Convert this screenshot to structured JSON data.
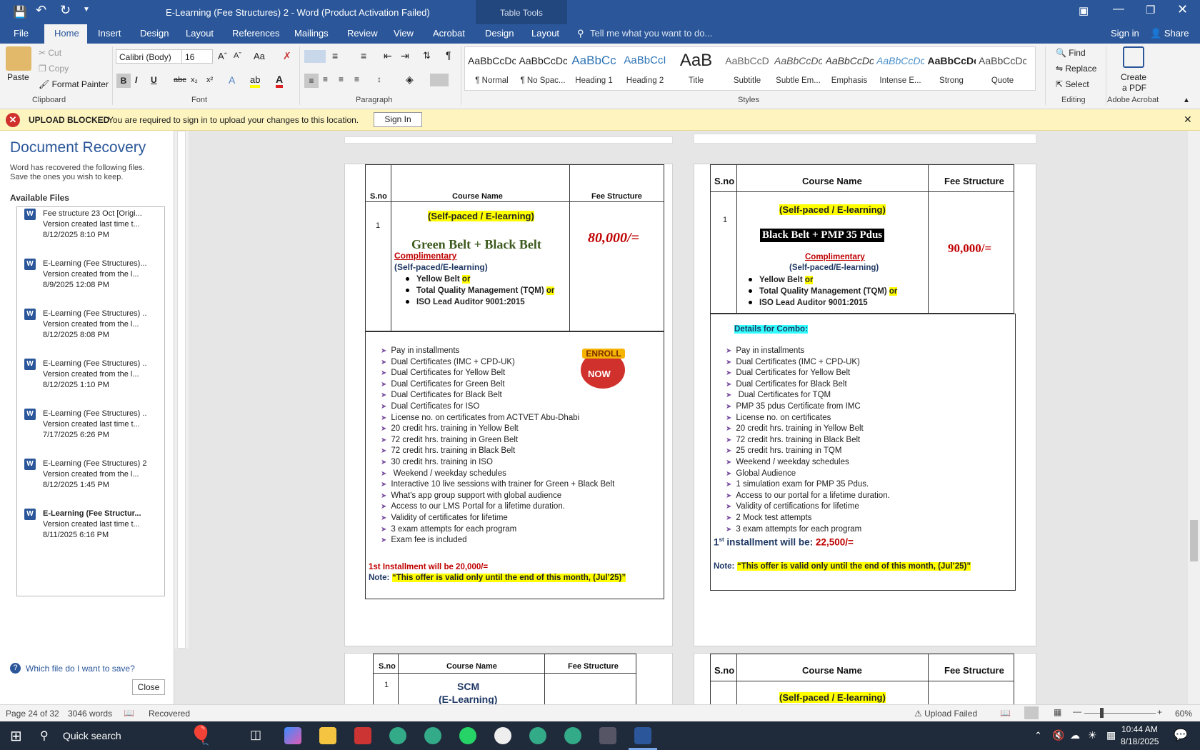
{
  "window": {
    "title": "E-Learning (Fee Structures) 2 - Word (Product Activation Failed)",
    "table_tools": "Table Tools"
  },
  "tabs": [
    "File",
    "Home",
    "Insert",
    "Design",
    "Layout",
    "References",
    "Mailings",
    "Review",
    "View",
    "Acrobat",
    "Design",
    "Layout"
  ],
  "tell_me": "Tell me what you want to do...",
  "sign_in": "Sign in",
  "share": "Share",
  "clipboard": {
    "paste": "Paste",
    "cut": "Cut",
    "copy": "Copy",
    "format_painter": "Format Painter",
    "label": "Clipboard"
  },
  "font": {
    "name": "Calibri (Body)",
    "size": "16",
    "label": "Font"
  },
  "paragraph": {
    "label": "Paragraph"
  },
  "styles": {
    "label": "Styles",
    "items": [
      {
        "preview": "AaBbCcDc",
        "name": "¶ Normal"
      },
      {
        "preview": "AaBbCcDc",
        "name": "¶ No Spac..."
      },
      {
        "preview": "AaBbCc",
        "name": "Heading 1"
      },
      {
        "preview": "AaBbCcI",
        "name": "Heading 2"
      },
      {
        "preview": "AaB",
        "name": "Title"
      },
      {
        "preview": "AaBbCcD",
        "name": "Subtitle"
      },
      {
        "preview": "AaBbCcDc",
        "name": "Subtle Em..."
      },
      {
        "preview": "AaBbCcDc",
        "name": "Emphasis"
      },
      {
        "preview": "AaBbCcDc",
        "name": "Intense E..."
      },
      {
        "preview": "AaBbCcDc",
        "name": "Strong"
      },
      {
        "preview": "AaBbCcDc",
        "name": "Quote"
      }
    ]
  },
  "editing": {
    "find": "Find",
    "replace": "Replace",
    "select": "Select",
    "label": "Editing"
  },
  "acrobat": {
    "create": "Create",
    "pdf": "a PDF",
    "label": "Adobe Acrobat"
  },
  "message": {
    "title": "UPLOAD BLOCKED",
    "text": "You are required to sign in to upload your changes to this location.",
    "button": "Sign In"
  },
  "recovery": {
    "title": "Document Recovery",
    "desc1": "Word has recovered the following files.",
    "desc2": "Save the ones you wish to keep.",
    "available": "Available Files",
    "help": "Which file do I want to save?",
    "close": "Close",
    "files": [
      {
        "name": "Fee structure 23 Oct  [Origi...",
        "ver": "Version created last time t...",
        "date": "8/12/2025 8:10 PM"
      },
      {
        "name": "E-Learning (Fee Structures)...",
        "ver": "Version created from the l...",
        "date": "8/9/2025 12:08 PM"
      },
      {
        "name": "E-Learning (Fee Structures) ..",
        "ver": "Version created from the l...",
        "date": "8/12/2025 8:08 PM"
      },
      {
        "name": "E-Learning (Fee Structures) ..",
        "ver": "Version created from the l...",
        "date": "8/12/2025 1:10 PM"
      },
      {
        "name": "E-Learning (Fee Structures) ..",
        "ver": "Version created last time t...",
        "date": "7/17/2025 6:26 PM"
      },
      {
        "name": "E-Learning (Fee Structures) 2",
        "ver": "Version created from the l...",
        "date": "8/12/2025 1:45 PM"
      },
      {
        "name": "E-Learning (Fee Structur...",
        "ver": "Version created last time t...",
        "date": "8/11/2025 6:16 PM"
      }
    ]
  },
  "table_headers": {
    "sno": "S.no",
    "course": "Course Name",
    "fee": "Fee Structure"
  },
  "left_doc": {
    "num": "1",
    "mode": "(Self-paced / E-learning)",
    "course": "Green Belt + Black Belt",
    "comp": "Complimentary",
    "comp_mode": "(Self-paced/E-learning)",
    "opt1": "Yellow Belt",
    "opt2": "Total Quality Management (TQM)",
    "opt3": "ISO Lead Auditor 9001:2015",
    "or": "or",
    "fee": "80,000/=",
    "enroll1": "ENROLL",
    "enroll2": "NOW",
    "bullets": [
      "Pay in installments",
      "Dual Certificates (IMC + CPD-UK)",
      "Dual Certificates for Yellow Belt",
      "Dual Certificates for Green Belt",
      "Dual Certificates for Black Belt",
      "Dual Certificates for  ISO",
      "License no. on certificates from ACTVET Abu-Dhabi",
      "20 credit hrs. training in Yellow Belt",
      "72 credit hrs. training in Green Belt",
      "72 credit hrs. training in Black Belt",
      "30 credit hrs. training in  ISO",
      " Weekend / weekday schedules",
      "Interactive 10 live sessions with trainer for Green + Black Belt",
      "What's app group support with global audience",
      "Access to our LMS Portal for a lifetime duration.",
      "Validity of certificates for lifetime",
      "3 exam attempts for each program",
      "Exam fee is included"
    ],
    "install": "1st Installment will be 20,000/=",
    "note_label": "Note:",
    "note": "“This offer is valid only until the end of this month, (Jul’25)”"
  },
  "right_doc": {
    "num": "1",
    "mode": "(Self-paced / E-learning)",
    "course": "Black Belt + PMP 35 Pdus",
    "comp": "Complimentary",
    "comp_mode": "(Self-paced/E-learning)",
    "opt1": "Yellow Belt",
    "opt2": "Total Quality Management (TQM)",
    "opt3": "ISO Lead Auditor 9001:2015",
    "or": "or",
    "fee": "90,000/=",
    "combo": "Details for Combo:",
    "bullets": [
      "Pay in installments",
      "Dual Certificates (IMC + CPD-UK)",
      "Dual Certificates for Yellow Belt",
      "Dual Certificates for Black Belt",
      " Dual Certificates for TQM",
      "PMP 35 pdus Certificate from IMC",
      "License no. on certificates",
      "20 credit hrs. training in Yellow Belt",
      "72 credit hrs. training in Black Belt",
      "25 credit hrs. training in TQM",
      "Weekend / weekday schedules",
      "Global Audience",
      "1 simulation exam for PMP 35 Pdus.",
      "Access to our portal for a lifetime duration.",
      "Validity of certifications for lifetime",
      "2 Mock test attempts",
      "3 exam attempts for each program"
    ],
    "install_a": "1",
    "install_sup": "st",
    "install_b": " installment will be: ",
    "install_amt": "22,500/=",
    "note_label": "Note:",
    "note": "“This offer is valid only until the end of this month, (Jul’25)”"
  },
  "bottom_left": {
    "num": "1",
    "course1": "SCM",
    "course2": "(E-Learning)"
  },
  "bottom_right": {
    "mode": "(Self-paced / E-learning)"
  },
  "status": {
    "page": "Page 24 of 32",
    "words": "3046 words",
    "recovered": "Recovered",
    "upload": "Upload Failed",
    "zoom": "60%"
  },
  "taskbar": {
    "search": "Quick search",
    "time": "10:44 AM",
    "date": "8/18/2025"
  }
}
